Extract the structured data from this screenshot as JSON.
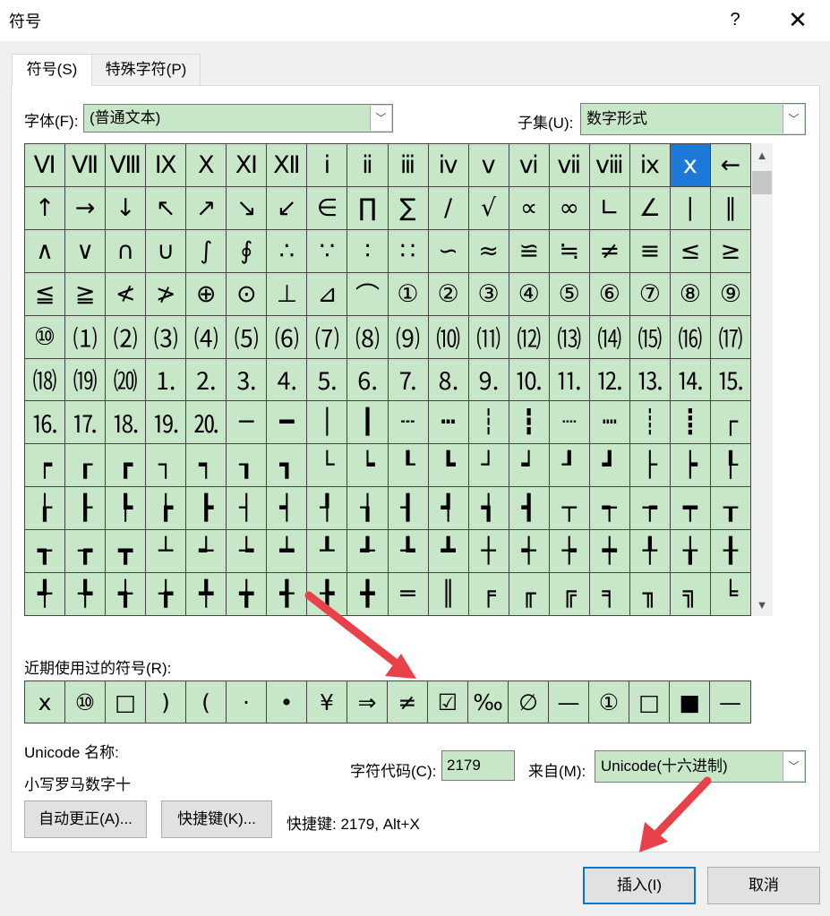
{
  "window": {
    "title": "符号",
    "help_label": "?",
    "close_label": "✕"
  },
  "tabs": [
    {
      "label": "符号(S)",
      "active": true
    },
    {
      "label": "特殊字符(P)",
      "active": false
    }
  ],
  "font": {
    "label": "字体(F):",
    "value": "(普通文本)"
  },
  "subset": {
    "label": "子集(U):",
    "value": "数字形式"
  },
  "symbols": [
    "Ⅵ",
    "Ⅶ",
    "Ⅷ",
    "Ⅸ",
    "Ⅹ",
    "Ⅺ",
    "Ⅻ",
    "ⅰ",
    "ⅱ",
    "ⅲ",
    "ⅳ",
    "ⅴ",
    "ⅵ",
    "ⅶ",
    "ⅷ",
    "ⅸ",
    "ⅹ",
    "←",
    "↑",
    "→",
    "↓",
    "↖",
    "↗",
    "↘",
    "↙",
    "∈",
    "∏",
    "∑",
    "∕",
    "√",
    "∝",
    "∞",
    "∟",
    "∠",
    "∣",
    "∥",
    "∧",
    "∨",
    "∩",
    "∪",
    "∫",
    "∮",
    "∴",
    "∵",
    "∶",
    "∷",
    "∽",
    "≈",
    "≌",
    "≒",
    "≠",
    "≡",
    "≤",
    "≥",
    "≦",
    "≧",
    "≮",
    "≯",
    "⊕",
    "⊙",
    "⊥",
    "⊿",
    "⌒",
    "①",
    "②",
    "③",
    "④",
    "⑤",
    "⑥",
    "⑦",
    "⑧",
    "⑨",
    "⑩",
    "⑴",
    "⑵",
    "⑶",
    "⑷",
    "⑸",
    "⑹",
    "⑺",
    "⑻",
    "⑼",
    "⑽",
    "⑾",
    "⑿",
    "⒀",
    "⒁",
    "⒂",
    "⒃",
    "⒄",
    "⒅",
    "⒆",
    "⒇",
    "⒈",
    "⒉",
    "⒊",
    "⒋",
    "⒌",
    "⒍",
    "⒎",
    "⒏",
    "⒐",
    "⒑",
    "⒒",
    "⒓",
    "⒔",
    "⒕",
    "⒖",
    "⒗",
    "⒘",
    "⒙",
    "⒚",
    "⒛",
    "─",
    "━",
    "│",
    "┃",
    "┄",
    "┅",
    "┆",
    "┇",
    "┈",
    "┉",
    "┊",
    "┋",
    "┌",
    "┍",
    "┎",
    "┏",
    "┐",
    "┑",
    "┒",
    "┓",
    "└",
    "┕",
    "┖",
    "┗",
    "┘",
    "┙",
    "┚",
    "┛",
    "├",
    "┝",
    "┞",
    "┟",
    "┠",
    "┡",
    "┢",
    "┣",
    "┤",
    "┥",
    "┦",
    "┧",
    "┨",
    "┩",
    "┪",
    "┫",
    "┬",
    "┭",
    "┮",
    "┯",
    "┰",
    "┱",
    "┲",
    "┳",
    "┴",
    "┵",
    "┶",
    "┷",
    "┸",
    "┹",
    "┺",
    "┻",
    "┼",
    "┽",
    "┾",
    "┿",
    "╀",
    "╁",
    "╂",
    "╃",
    "╄",
    "╅",
    "╆",
    "╇",
    "╈",
    "╉",
    "╊",
    "╋",
    "═",
    "║",
    "╒",
    "╓",
    "╔",
    "╕",
    "╖",
    "╗",
    "╘"
  ],
  "selected_symbol": "ⅹ",
  "recent": {
    "label": "近期使用过的符号(R):",
    "symbols": [
      "x",
      "⑩",
      "□",
      ")",
      "(",
      "·",
      "•",
      "¥",
      "⇒",
      "≠",
      "☑",
      "‰",
      "∅",
      "—",
      "①",
      "□",
      "■",
      "—"
    ]
  },
  "unicode_name": {
    "label": "Unicode 名称:",
    "value": "小写罗马数字十"
  },
  "char_code": {
    "label": "字符代码(C):",
    "value": "2179"
  },
  "from": {
    "label": "来自(M):",
    "value": "Unicode(十六进制)"
  },
  "buttons": {
    "autocorrect": "自动更正(A)...",
    "shortcut_key": "快捷键(K)...",
    "shortcut_text": "快捷键: 2179, Alt+X",
    "insert": "插入(I)",
    "cancel": "取消"
  },
  "colors": {
    "grid_bg": "#c8e6c8",
    "selected": "#1e78d8",
    "annotation_arrow": "#e8414a"
  }
}
